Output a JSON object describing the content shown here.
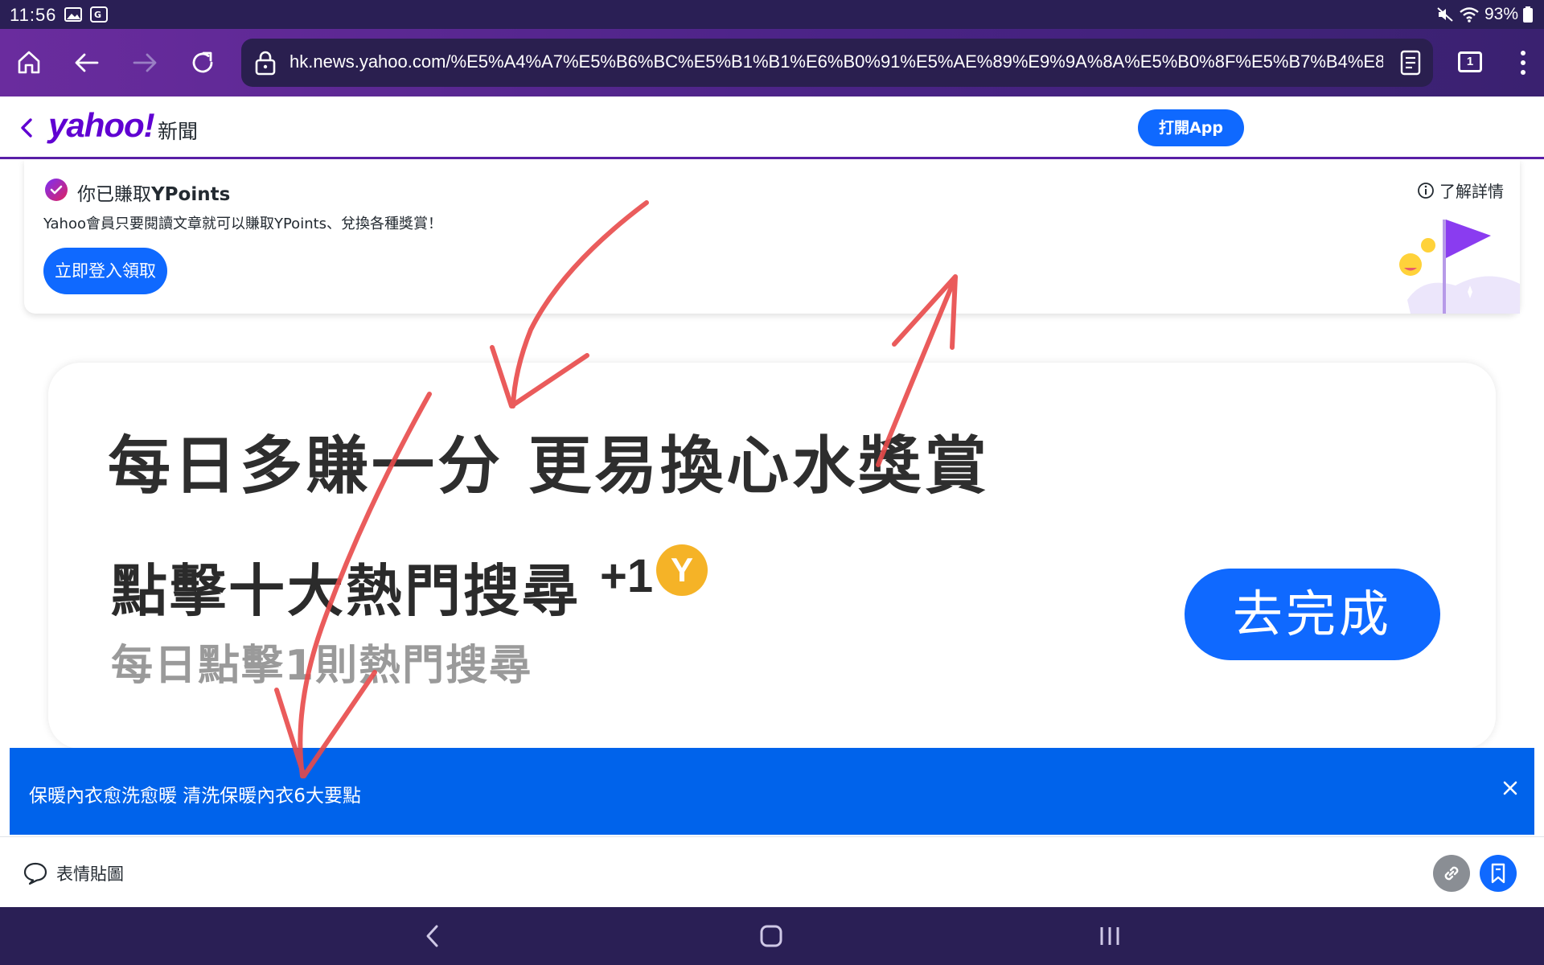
{
  "status_bar": {
    "time": "11:56",
    "battery": "93%"
  },
  "browser": {
    "url": "hk.news.yahoo.com/%E5%A4%A7%E5%B6%BC%E5%B1%B1%E6%B0%91%E5%AE%89%E9%9A%8A%E5%B0%8F%E5%B7%B4%E8%88%87%E7",
    "tab_count": "1"
  },
  "header": {
    "logo": "yahoo!",
    "section": "新聞",
    "open_app": "打開App"
  },
  "ypoints": {
    "title_prefix": "你已賺取",
    "title_bold": "YPoints",
    "description": "Yahoo會員只要閱讀文章就可以賺取YPoints、兌換各種獎賞！",
    "login_button": "立即登入領取",
    "more_info": "了解詳情"
  },
  "task_card": {
    "headline": "每日多賺一分 更易換心水獎賞",
    "task": "點擊十大熱門搜尋",
    "points": "+1",
    "coin": "Y",
    "subtext": "每日點擊1則熱門搜尋",
    "go_button": "去完成"
  },
  "banner": {
    "text": "保暖內衣愈洗愈暖 清洗保暖內衣6大要點"
  },
  "action_bar": {
    "emoji_label": "表情貼圖"
  },
  "colors": {
    "status_bar": "#2a1f55",
    "browser_bar": "#4a2386",
    "yahoo_purple": "#6001d2",
    "yahoo_blue": "#0f69ff",
    "banner_blue": "#0063eb",
    "annotation_red": "#e84a4a"
  }
}
